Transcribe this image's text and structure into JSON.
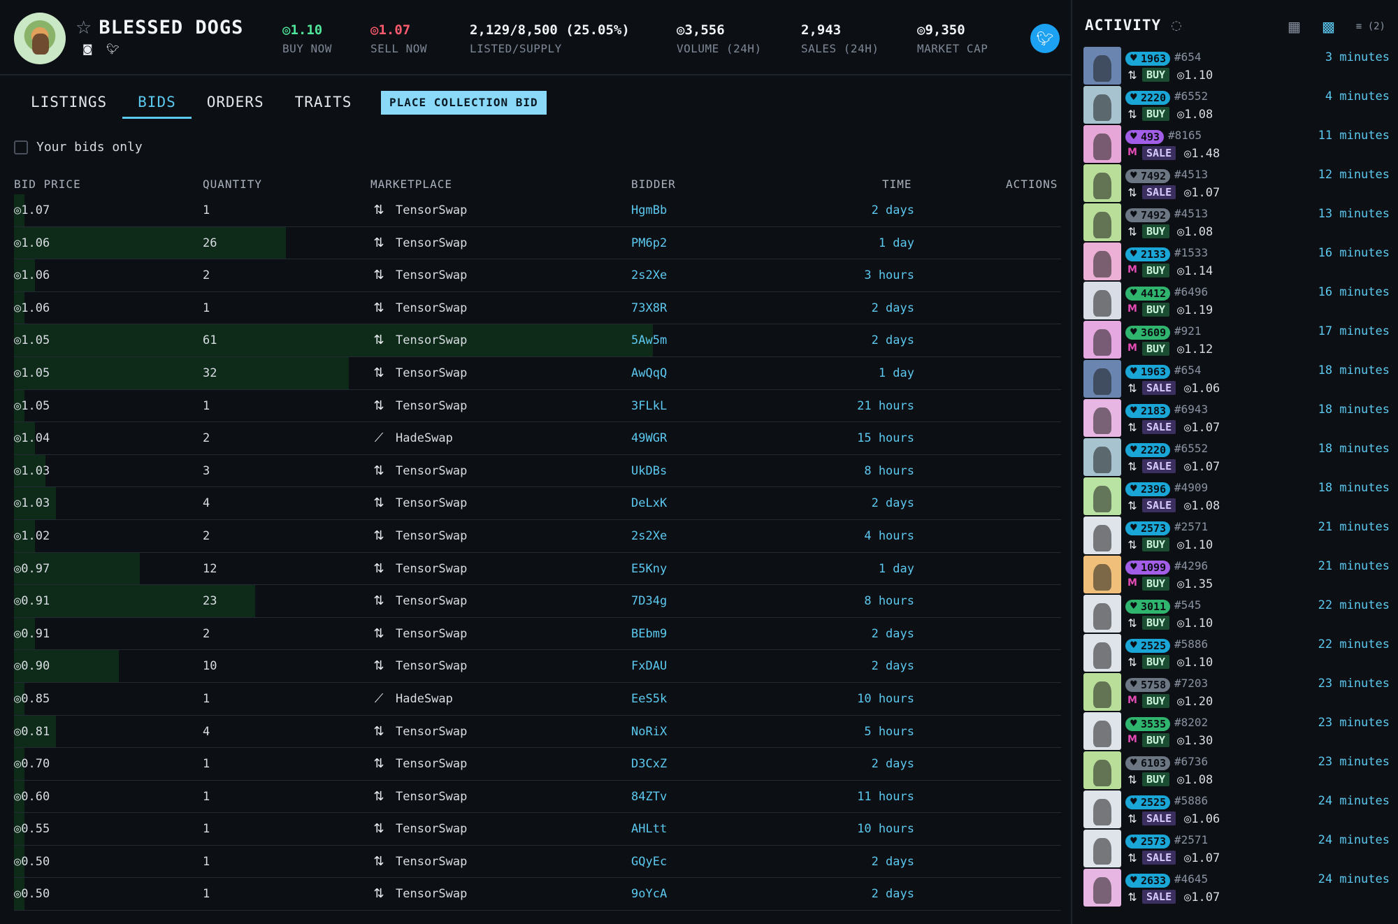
{
  "collection": {
    "name": "BLESSED DOGS",
    "stats": [
      {
        "value": "◎1.10",
        "label": "BUY NOW",
        "tone": "green"
      },
      {
        "value": "◎1.07",
        "label": "SELL NOW",
        "tone": "red"
      },
      {
        "value": "2,129/8,500 (25.05%)",
        "label": "LISTED/SUPPLY",
        "tone": "white"
      },
      {
        "value": "◎3,556",
        "label": "VOLUME (24H)",
        "tone": "white"
      },
      {
        "value": "2,943",
        "label": "SALES (24H)",
        "tone": "white"
      },
      {
        "value": "◎9,350",
        "label": "MARKET CAP",
        "tone": "white"
      }
    ]
  },
  "tabs": [
    "LISTINGS",
    "BIDS",
    "ORDERS",
    "TRAITS"
  ],
  "active_tab": "BIDS",
  "place_bid_label": "PLACE COLLECTION BID",
  "your_bids_label": "Your bids only",
  "columns": {
    "price": "BID PRICE",
    "quantity": "QUANTITY",
    "marketplace": "MARKETPLACE",
    "bidder": "BIDDER",
    "time": "TIME",
    "actions": "ACTIONS"
  },
  "bids": [
    {
      "price": "◎1.07",
      "qty": "1",
      "mkt": "TensorSwap",
      "bidder": "HgmBb",
      "time": "2 days",
      "fill": 0.01
    },
    {
      "price": "◎1.06",
      "qty": "26",
      "mkt": "TensorSwap",
      "bidder": "PM6p2",
      "time": "1 day",
      "fill": 0.26
    },
    {
      "price": "◎1.06",
      "qty": "2",
      "mkt": "TensorSwap",
      "bidder": "2s2Xe",
      "time": "3 hours",
      "fill": 0.02
    },
    {
      "price": "◎1.06",
      "qty": "1",
      "mkt": "TensorSwap",
      "bidder": "73X8R",
      "time": "2 days",
      "fill": 0.01
    },
    {
      "price": "◎1.05",
      "qty": "61",
      "mkt": "TensorSwap",
      "bidder": "5Aw5m",
      "time": "2 days",
      "fill": 0.61
    },
    {
      "price": "◎1.05",
      "qty": "32",
      "mkt": "TensorSwap",
      "bidder": "AwQqQ",
      "time": "1 day",
      "fill": 0.32
    },
    {
      "price": "◎1.05",
      "qty": "1",
      "mkt": "TensorSwap",
      "bidder": "3FLkL",
      "time": "21 hours",
      "fill": 0.01
    },
    {
      "price": "◎1.04",
      "qty": "2",
      "mkt": "HadeSwap",
      "bidder": "49WGR",
      "time": "15 hours",
      "fill": 0.02
    },
    {
      "price": "◎1.03",
      "qty": "3",
      "mkt": "TensorSwap",
      "bidder": "UkDBs",
      "time": "8 hours",
      "fill": 0.03
    },
    {
      "price": "◎1.03",
      "qty": "4",
      "mkt": "TensorSwap",
      "bidder": "DeLxK",
      "time": "2 days",
      "fill": 0.04
    },
    {
      "price": "◎1.02",
      "qty": "2",
      "mkt": "TensorSwap",
      "bidder": "2s2Xe",
      "time": "4 hours",
      "fill": 0.02
    },
    {
      "price": "◎0.97",
      "qty": "12",
      "mkt": "TensorSwap",
      "bidder": "E5Kny",
      "time": "1 day",
      "fill": 0.12
    },
    {
      "price": "◎0.91",
      "qty": "23",
      "mkt": "TensorSwap",
      "bidder": "7D34g",
      "time": "8 hours",
      "fill": 0.23
    },
    {
      "price": "◎0.91",
      "qty": "2",
      "mkt": "TensorSwap",
      "bidder": "BEbm9",
      "time": "2 days",
      "fill": 0.02
    },
    {
      "price": "◎0.90",
      "qty": "10",
      "mkt": "TensorSwap",
      "bidder": "FxDAU",
      "time": "2 days",
      "fill": 0.1
    },
    {
      "price": "◎0.85",
      "qty": "1",
      "mkt": "HadeSwap",
      "bidder": "EeS5k",
      "time": "10 hours",
      "fill": 0.01
    },
    {
      "price": "◎0.81",
      "qty": "4",
      "mkt": "TensorSwap",
      "bidder": "NoRiX",
      "time": "5 hours",
      "fill": 0.04
    },
    {
      "price": "◎0.70",
      "qty": "1",
      "mkt": "TensorSwap",
      "bidder": "D3CxZ",
      "time": "2 days",
      "fill": 0.01
    },
    {
      "price": "◎0.60",
      "qty": "1",
      "mkt": "TensorSwap",
      "bidder": "84ZTv",
      "time": "11 hours",
      "fill": 0.01
    },
    {
      "price": "◎0.55",
      "qty": "1",
      "mkt": "TensorSwap",
      "bidder": "AHLtt",
      "time": "10 hours",
      "fill": 0.01
    },
    {
      "price": "◎0.50",
      "qty": "1",
      "mkt": "TensorSwap",
      "bidder": "GQyEc",
      "time": "2 days",
      "fill": 0.01
    },
    {
      "price": "◎0.50",
      "qty": "1",
      "mkt": "TensorSwap",
      "bidder": "9oYcA",
      "time": "2 days",
      "fill": 0.01
    }
  ],
  "activity": {
    "title": "ACTIVITY",
    "filter_count": "(2)",
    "items": [
      {
        "rank": "1963",
        "rank_color": "blue",
        "token": "#654",
        "mkt": "tensor",
        "type": "BUY",
        "price": "◎1.10",
        "time": "3 minutes",
        "bg": "#6a86b0"
      },
      {
        "rank": "2220",
        "rank_color": "blue",
        "token": "#6552",
        "mkt": "tensor",
        "type": "BUY",
        "price": "◎1.08",
        "time": "4 minutes",
        "bg": "#a7c3cf"
      },
      {
        "rank": "493",
        "rank_color": "purple",
        "token": "#8165",
        "mkt": "me",
        "type": "SALE",
        "price": "◎1.48",
        "time": "11 minutes",
        "bg": "#e7a6d8"
      },
      {
        "rank": "7492",
        "rank_color": "gray",
        "token": "#4513",
        "mkt": "tensor",
        "type": "SALE",
        "price": "◎1.07",
        "time": "12 minutes",
        "bg": "#b8de9a"
      },
      {
        "rank": "7492",
        "rank_color": "gray",
        "token": "#4513",
        "mkt": "tensor",
        "type": "BUY",
        "price": "◎1.08",
        "time": "13 minutes",
        "bg": "#b8de9a"
      },
      {
        "rank": "2133",
        "rank_color": "blue",
        "token": "#1533",
        "mkt": "me",
        "type": "BUY",
        "price": "◎1.14",
        "time": "16 minutes",
        "bg": "#ecb0d6"
      },
      {
        "rank": "4412",
        "rank_color": "green",
        "token": "#6496",
        "mkt": "me",
        "type": "BUY",
        "price": "◎1.19",
        "time": "16 minutes",
        "bg": "#d9dee6"
      },
      {
        "rank": "3609",
        "rank_color": "green",
        "token": "#921",
        "mkt": "me",
        "type": "BUY",
        "price": "◎1.12",
        "time": "17 minutes",
        "bg": "#e6a8e0"
      },
      {
        "rank": "1963",
        "rank_color": "blue",
        "token": "#654",
        "mkt": "tensor",
        "type": "SALE",
        "price": "◎1.06",
        "time": "18 minutes",
        "bg": "#6a86b0"
      },
      {
        "rank": "2183",
        "rank_color": "blue",
        "token": "#6943",
        "mkt": "tensor",
        "type": "SALE",
        "price": "◎1.07",
        "time": "18 minutes",
        "bg": "#e8b6e2"
      },
      {
        "rank": "2220",
        "rank_color": "blue",
        "token": "#6552",
        "mkt": "tensor",
        "type": "SALE",
        "price": "◎1.07",
        "time": "18 minutes",
        "bg": "#a7c3cf"
      },
      {
        "rank": "2396",
        "rank_color": "blue",
        "token": "#4909",
        "mkt": "tensor",
        "type": "SALE",
        "price": "◎1.08",
        "time": "18 minutes",
        "bg": "#b9e3a2"
      },
      {
        "rank": "2573",
        "rank_color": "blue",
        "token": "#2571",
        "mkt": "tensor",
        "type": "BUY",
        "price": "◎1.10",
        "time": "21 minutes",
        "bg": "#dfe4ea"
      },
      {
        "rank": "1099",
        "rank_color": "purple",
        "token": "#4296",
        "mkt": "me",
        "type": "BUY",
        "price": "◎1.35",
        "time": "21 minutes",
        "bg": "#f0c07a"
      },
      {
        "rank": "3011",
        "rank_color": "green",
        "token": "#545",
        "mkt": "tensor",
        "type": "BUY",
        "price": "◎1.10",
        "time": "22 minutes",
        "bg": "#dfe4ea"
      },
      {
        "rank": "2525",
        "rank_color": "blue",
        "token": "#5886",
        "mkt": "tensor",
        "type": "BUY",
        "price": "◎1.10",
        "time": "22 minutes",
        "bg": "#dfe4ea"
      },
      {
        "rank": "5758",
        "rank_color": "gray",
        "token": "#7203",
        "mkt": "me",
        "type": "BUY",
        "price": "◎1.20",
        "time": "23 minutes",
        "bg": "#b8de9a"
      },
      {
        "rank": "3535",
        "rank_color": "green",
        "token": "#8202",
        "mkt": "me",
        "type": "BUY",
        "price": "◎1.30",
        "time": "23 minutes",
        "bg": "#dfe4ea"
      },
      {
        "rank": "6103",
        "rank_color": "gray",
        "token": "#6736",
        "mkt": "tensor",
        "type": "BUY",
        "price": "◎1.08",
        "time": "23 minutes",
        "bg": "#b8de9a"
      },
      {
        "rank": "2525",
        "rank_color": "blue",
        "token": "#5886",
        "mkt": "tensor",
        "type": "SALE",
        "price": "◎1.06",
        "time": "24 minutes",
        "bg": "#dfe4ea"
      },
      {
        "rank": "2573",
        "rank_color": "blue",
        "token": "#2571",
        "mkt": "tensor",
        "type": "SALE",
        "price": "◎1.07",
        "time": "24 minutes",
        "bg": "#dfe4ea"
      },
      {
        "rank": "2633",
        "rank_color": "blue",
        "token": "#4645",
        "mkt": "tensor",
        "type": "SALE",
        "price": "◎1.07",
        "time": "24 minutes",
        "bg": "#e8b6e2"
      }
    ]
  }
}
